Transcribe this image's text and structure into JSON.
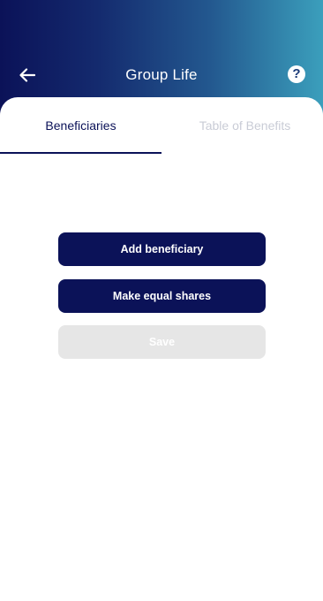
{
  "header": {
    "title": "Group Life",
    "back_icon": "arrow-left-icon",
    "help_icon": "question-circle-icon",
    "help_glyph": "?"
  },
  "tabs": [
    {
      "label": "Beneficiaries",
      "active": true
    },
    {
      "label": "Table of Benefits",
      "active": false
    }
  ],
  "actions": {
    "add_beneficiary": "Add beneficiary",
    "make_equal_shares": "Make equal shares",
    "save": "Save"
  },
  "colors": {
    "primary": "#0b1258",
    "gradient_start": "#0b1258",
    "gradient_end": "#3b9fbc",
    "disabled_bg": "#e6e6e6",
    "inactive_tab_text": "#c9ccd6"
  }
}
